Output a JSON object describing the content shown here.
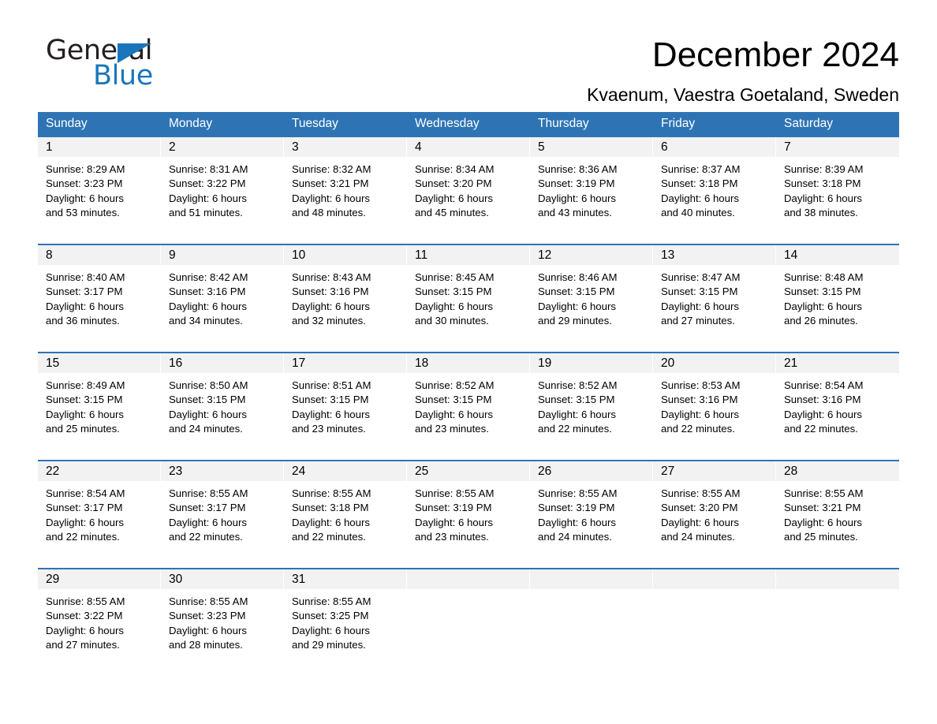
{
  "brand": {
    "name_part1": "General",
    "name_part2": "Blue",
    "accent_color": "#1a76bc"
  },
  "header": {
    "title": "December 2024",
    "location": "Kvaenum, Vaestra Goetaland, Sweden"
  },
  "calendar": {
    "header_color": "#2e74b5",
    "daynum_bg": "#f2f2f2",
    "day_names": [
      "Sunday",
      "Monday",
      "Tuesday",
      "Wednesday",
      "Thursday",
      "Friday",
      "Saturday"
    ],
    "weeks": [
      {
        "cells": [
          {
            "day": "1",
            "sunrise": "Sunrise: 8:29 AM",
            "sunset": "Sunset: 3:23 PM",
            "daylight_line1": "Daylight: 6 hours",
            "daylight_line2": "and 53 minutes."
          },
          {
            "day": "2",
            "sunrise": "Sunrise: 8:31 AM",
            "sunset": "Sunset: 3:22 PM",
            "daylight_line1": "Daylight: 6 hours",
            "daylight_line2": "and 51 minutes."
          },
          {
            "day": "3",
            "sunrise": "Sunrise: 8:32 AM",
            "sunset": "Sunset: 3:21 PM",
            "daylight_line1": "Daylight: 6 hours",
            "daylight_line2": "and 48 minutes."
          },
          {
            "day": "4",
            "sunrise": "Sunrise: 8:34 AM",
            "sunset": "Sunset: 3:20 PM",
            "daylight_line1": "Daylight: 6 hours",
            "daylight_line2": "and 45 minutes."
          },
          {
            "day": "5",
            "sunrise": "Sunrise: 8:36 AM",
            "sunset": "Sunset: 3:19 PM",
            "daylight_line1": "Daylight: 6 hours",
            "daylight_line2": "and 43 minutes."
          },
          {
            "day": "6",
            "sunrise": "Sunrise: 8:37 AM",
            "sunset": "Sunset: 3:18 PM",
            "daylight_line1": "Daylight: 6 hours",
            "daylight_line2": "and 40 minutes."
          },
          {
            "day": "7",
            "sunrise": "Sunrise: 8:39 AM",
            "sunset": "Sunset: 3:18 PM",
            "daylight_line1": "Daylight: 6 hours",
            "daylight_line2": "and 38 minutes."
          }
        ]
      },
      {
        "cells": [
          {
            "day": "8",
            "sunrise": "Sunrise: 8:40 AM",
            "sunset": "Sunset: 3:17 PM",
            "daylight_line1": "Daylight: 6 hours",
            "daylight_line2": "and 36 minutes."
          },
          {
            "day": "9",
            "sunrise": "Sunrise: 8:42 AM",
            "sunset": "Sunset: 3:16 PM",
            "daylight_line1": "Daylight: 6 hours",
            "daylight_line2": "and 34 minutes."
          },
          {
            "day": "10",
            "sunrise": "Sunrise: 8:43 AM",
            "sunset": "Sunset: 3:16 PM",
            "daylight_line1": "Daylight: 6 hours",
            "daylight_line2": "and 32 minutes."
          },
          {
            "day": "11",
            "sunrise": "Sunrise: 8:45 AM",
            "sunset": "Sunset: 3:15 PM",
            "daylight_line1": "Daylight: 6 hours",
            "daylight_line2": "and 30 minutes."
          },
          {
            "day": "12",
            "sunrise": "Sunrise: 8:46 AM",
            "sunset": "Sunset: 3:15 PM",
            "daylight_line1": "Daylight: 6 hours",
            "daylight_line2": "and 29 minutes."
          },
          {
            "day": "13",
            "sunrise": "Sunrise: 8:47 AM",
            "sunset": "Sunset: 3:15 PM",
            "daylight_line1": "Daylight: 6 hours",
            "daylight_line2": "and 27 minutes."
          },
          {
            "day": "14",
            "sunrise": "Sunrise: 8:48 AM",
            "sunset": "Sunset: 3:15 PM",
            "daylight_line1": "Daylight: 6 hours",
            "daylight_line2": "and 26 minutes."
          }
        ]
      },
      {
        "cells": [
          {
            "day": "15",
            "sunrise": "Sunrise: 8:49 AM",
            "sunset": "Sunset: 3:15 PM",
            "daylight_line1": "Daylight: 6 hours",
            "daylight_line2": "and 25 minutes."
          },
          {
            "day": "16",
            "sunrise": "Sunrise: 8:50 AM",
            "sunset": "Sunset: 3:15 PM",
            "daylight_line1": "Daylight: 6 hours",
            "daylight_line2": "and 24 minutes."
          },
          {
            "day": "17",
            "sunrise": "Sunrise: 8:51 AM",
            "sunset": "Sunset: 3:15 PM",
            "daylight_line1": "Daylight: 6 hours",
            "daylight_line2": "and 23 minutes."
          },
          {
            "day": "18",
            "sunrise": "Sunrise: 8:52 AM",
            "sunset": "Sunset: 3:15 PM",
            "daylight_line1": "Daylight: 6 hours",
            "daylight_line2": "and 23 minutes."
          },
          {
            "day": "19",
            "sunrise": "Sunrise: 8:52 AM",
            "sunset": "Sunset: 3:15 PM",
            "daylight_line1": "Daylight: 6 hours",
            "daylight_line2": "and 22 minutes."
          },
          {
            "day": "20",
            "sunrise": "Sunrise: 8:53 AM",
            "sunset": "Sunset: 3:16 PM",
            "daylight_line1": "Daylight: 6 hours",
            "daylight_line2": "and 22 minutes."
          },
          {
            "day": "21",
            "sunrise": "Sunrise: 8:54 AM",
            "sunset": "Sunset: 3:16 PM",
            "daylight_line1": "Daylight: 6 hours",
            "daylight_line2": "and 22 minutes."
          }
        ]
      },
      {
        "cells": [
          {
            "day": "22",
            "sunrise": "Sunrise: 8:54 AM",
            "sunset": "Sunset: 3:17 PM",
            "daylight_line1": "Daylight: 6 hours",
            "daylight_line2": "and 22 minutes."
          },
          {
            "day": "23",
            "sunrise": "Sunrise: 8:55 AM",
            "sunset": "Sunset: 3:17 PM",
            "daylight_line1": "Daylight: 6 hours",
            "daylight_line2": "and 22 minutes."
          },
          {
            "day": "24",
            "sunrise": "Sunrise: 8:55 AM",
            "sunset": "Sunset: 3:18 PM",
            "daylight_line1": "Daylight: 6 hours",
            "daylight_line2": "and 22 minutes."
          },
          {
            "day": "25",
            "sunrise": "Sunrise: 8:55 AM",
            "sunset": "Sunset: 3:19 PM",
            "daylight_line1": "Daylight: 6 hours",
            "daylight_line2": "and 23 minutes."
          },
          {
            "day": "26",
            "sunrise": "Sunrise: 8:55 AM",
            "sunset": "Sunset: 3:19 PM",
            "daylight_line1": "Daylight: 6 hours",
            "daylight_line2": "and 24 minutes."
          },
          {
            "day": "27",
            "sunrise": "Sunrise: 8:55 AM",
            "sunset": "Sunset: 3:20 PM",
            "daylight_line1": "Daylight: 6 hours",
            "daylight_line2": "and 24 minutes."
          },
          {
            "day": "28",
            "sunrise": "Sunrise: 8:55 AM",
            "sunset": "Sunset: 3:21 PM",
            "daylight_line1": "Daylight: 6 hours",
            "daylight_line2": "and 25 minutes."
          }
        ]
      },
      {
        "cells": [
          {
            "day": "29",
            "sunrise": "Sunrise: 8:55 AM",
            "sunset": "Sunset: 3:22 PM",
            "daylight_line1": "Daylight: 6 hours",
            "daylight_line2": "and 27 minutes."
          },
          {
            "day": "30",
            "sunrise": "Sunrise: 8:55 AM",
            "sunset": "Sunset: 3:23 PM",
            "daylight_line1": "Daylight: 6 hours",
            "daylight_line2": "and 28 minutes."
          },
          {
            "day": "31",
            "sunrise": "Sunrise: 8:55 AM",
            "sunset": "Sunset: 3:25 PM",
            "daylight_line1": "Daylight: 6 hours",
            "daylight_line2": "and 29 minutes."
          },
          {
            "day": "",
            "sunrise": "",
            "sunset": "",
            "daylight_line1": "",
            "daylight_line2": ""
          },
          {
            "day": "",
            "sunrise": "",
            "sunset": "",
            "daylight_line1": "",
            "daylight_line2": ""
          },
          {
            "day": "",
            "sunrise": "",
            "sunset": "",
            "daylight_line1": "",
            "daylight_line2": ""
          },
          {
            "day": "",
            "sunrise": "",
            "sunset": "",
            "daylight_line1": "",
            "daylight_line2": ""
          }
        ]
      }
    ]
  }
}
